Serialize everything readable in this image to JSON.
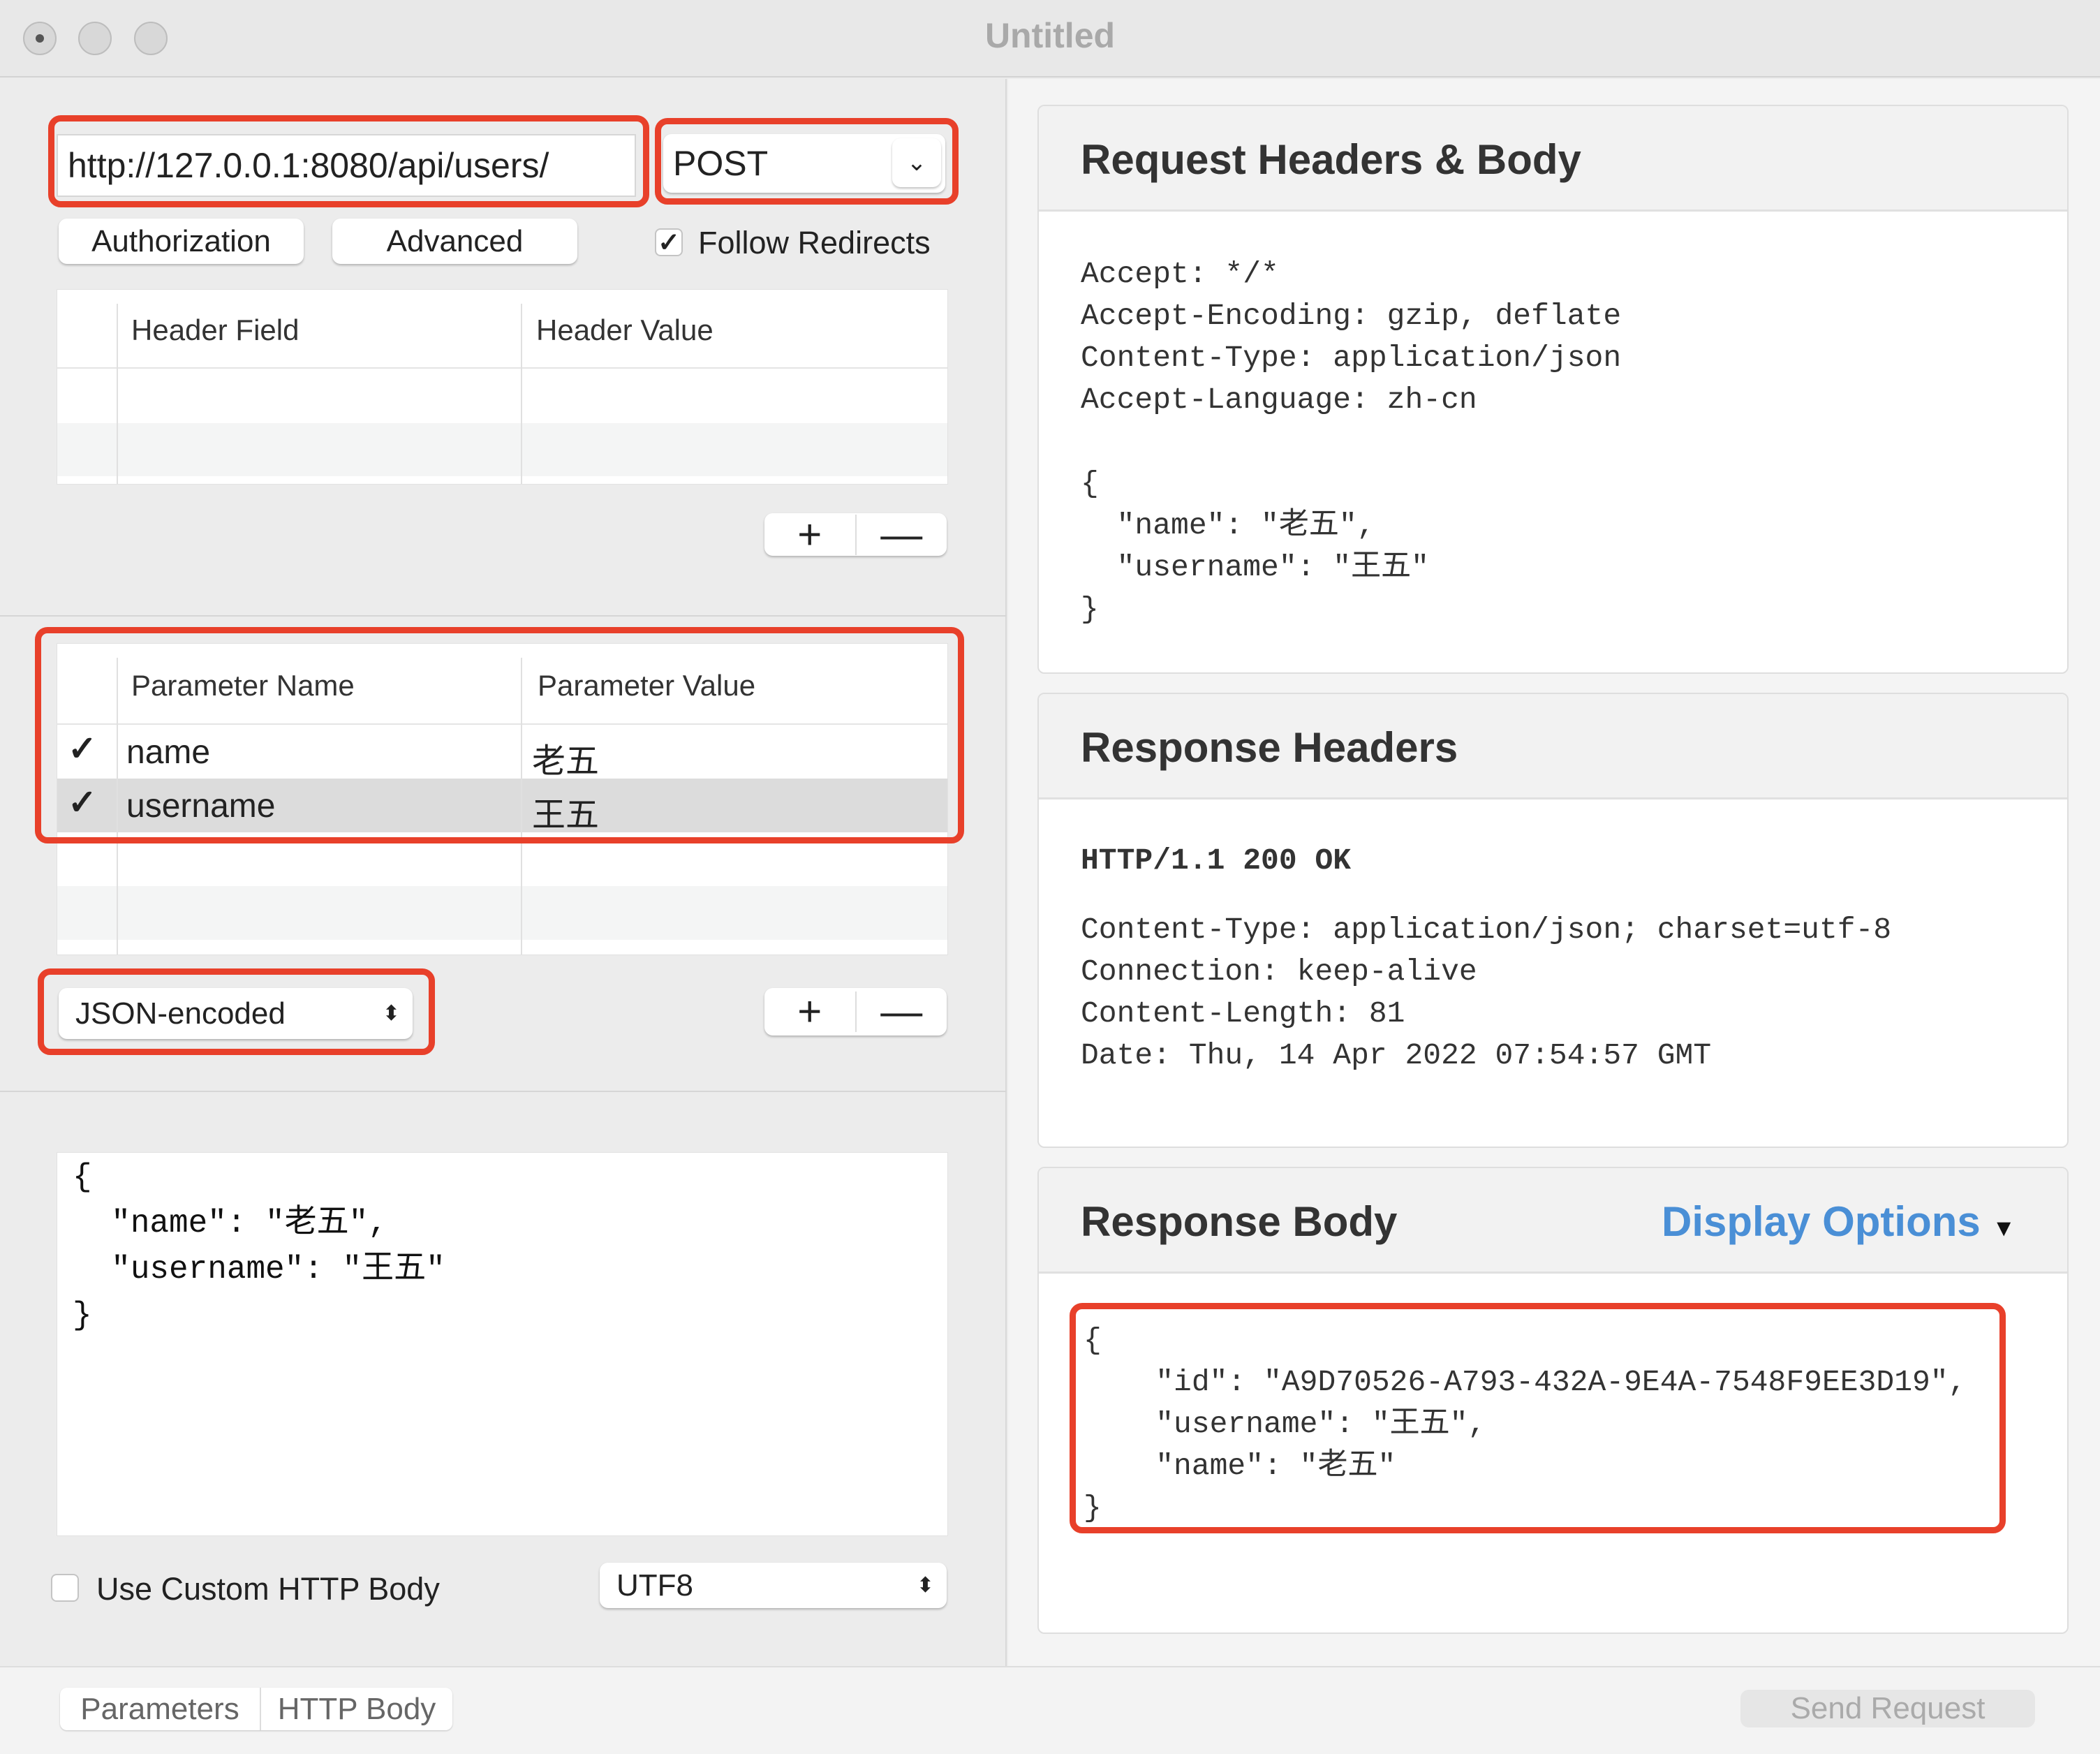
{
  "window": {
    "title": "Untitled"
  },
  "request": {
    "url": "http://127.0.0.1:8080/api/users/",
    "method": "POST",
    "authorization_label": "Authorization",
    "advanced_label": "Advanced",
    "follow_redirects_label": "Follow Redirects",
    "follow_redirects_checked": true
  },
  "headers_table": {
    "columns": [
      "Header Field",
      "Header Value"
    ],
    "rows": []
  },
  "params_table": {
    "columns": [
      "Parameter Name",
      "Parameter Value"
    ],
    "rows": [
      {
        "enabled": true,
        "name": "name",
        "value": "老五"
      },
      {
        "enabled": true,
        "name": "username",
        "value": "王五"
      }
    ]
  },
  "add_label": "+",
  "remove_label": "—",
  "encoding_select": "JSON-encoded",
  "body_text": "{\n  \"name\": \"老五\",\n  \"username\": \"王五\"\n}",
  "use_custom_body_label": "Use Custom HTTP Body",
  "charset_select": "UTF8",
  "bottom_tabs": [
    "Parameters",
    "HTTP Body"
  ],
  "send_label": "Send Request",
  "request_panel": {
    "title": "Request Headers & Body",
    "text": "Accept: */*\nAccept-Encoding: gzip, deflate\nContent-Type: application/json\nAccept-Language: zh-cn\n\n{\n  \"name\": \"老五\",\n  \"username\": \"王五\"\n}"
  },
  "response_headers_panel": {
    "title": "Response Headers",
    "status": "HTTP/1.1 200 OK",
    "text": "Content-Type: application/json; charset=utf-8\nConnection: keep-alive\nContent-Length: 81\nDate: Thu, 14 Apr 2022 07:54:57 GMT"
  },
  "response_body_panel": {
    "title": "Response Body",
    "display_options": "Display Options",
    "text": "{\n    \"id\": \"A9D70526-A793-432A-9E4A-7548F9EE3D19\",\n    \"username\": \"王五\",\n    \"name\": \"老五\"\n}"
  },
  "colors": {
    "highlight": "#e8402a",
    "link": "#4a8fd6"
  }
}
